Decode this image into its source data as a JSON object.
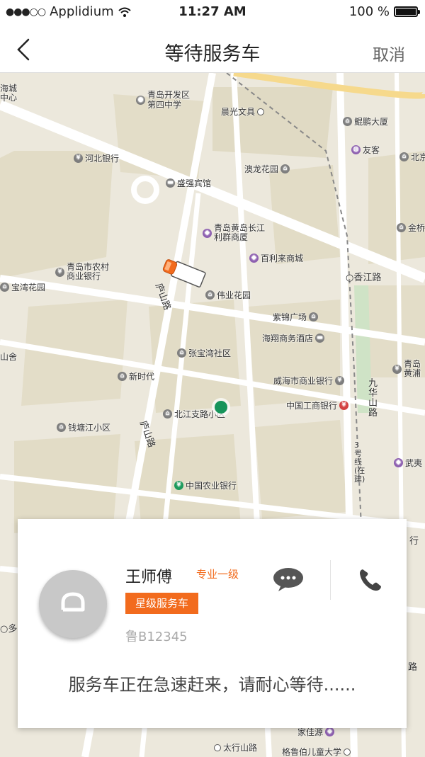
{
  "status_bar": {
    "carrier": "Applidium",
    "time": "11:27 AM",
    "battery": "100 %"
  },
  "nav": {
    "title": "等待服务车",
    "cancel_label": "取消"
  },
  "map": {
    "pois": [
      {
        "label": "青岛开发区\n第四中学",
        "icon": "school-icon"
      },
      {
        "label": "晨光文具",
        "icon": "dot-icon"
      },
      {
        "label": "鲲鹏大厦",
        "icon": "building-icon"
      },
      {
        "label": "友客",
        "icon": "shop-icon"
      },
      {
        "label": "北京",
        "icon": "building-icon"
      },
      {
        "label": "河北银行",
        "icon": "bank-icon"
      },
      {
        "label": "澳龙花园",
        "icon": "building-icon"
      },
      {
        "label": "盛强宾馆",
        "icon": "hotel-icon"
      },
      {
        "label": "青岛黄岛长江\n利群商厦",
        "icon": "mall-icon"
      },
      {
        "label": "金桥",
        "icon": "building-icon"
      },
      {
        "label": "百利来商城",
        "icon": "mall-icon"
      },
      {
        "label": "青岛市农村\n商业银行",
        "icon": "bank-icon"
      },
      {
        "label": "宝湾花园",
        "icon": "building-icon"
      },
      {
        "label": "伟业花园",
        "icon": "building-icon"
      },
      {
        "label": "紫锦广场",
        "icon": "building-icon"
      },
      {
        "label": "海翔商务酒店",
        "icon": "hotel-icon"
      },
      {
        "label": "张宝湾社区",
        "icon": "building-icon"
      },
      {
        "label": "新时代",
        "icon": "building-icon"
      },
      {
        "label": "威海市商业银行",
        "icon": "bank-icon"
      },
      {
        "label": "中国工商银行",
        "icon": "bank-icon"
      },
      {
        "label": "青岛\n黄浦",
        "icon": "bank-icon"
      },
      {
        "label": "北江支路小区",
        "icon": "building-icon"
      },
      {
        "label": "钱塘江小区",
        "icon": "building-icon"
      },
      {
        "label": "武夷",
        "icon": "mall-icon"
      },
      {
        "label": "中国农业银行",
        "icon": "bank-icon"
      },
      {
        "label": "太行山路",
        "icon": "dot-icon"
      },
      {
        "label": "格鲁伯儿童大学",
        "icon": "dot-icon"
      },
      {
        "label": "家佳源",
        "icon": "mall-icon"
      }
    ],
    "roads": [
      "香江路",
      "庐山路",
      "庐山路",
      "九华山路",
      "3号线(在建)"
    ],
    "edge_labels": [
      "海城\n中心",
      "山舍",
      "多",
      "行",
      "路"
    ]
  },
  "driver": {
    "name": "王师傅",
    "level": "专业一级",
    "badge": "星级服务车",
    "plate": "鲁B12345",
    "status_message": "服务车正在急速赶来，请耐心等待......"
  }
}
